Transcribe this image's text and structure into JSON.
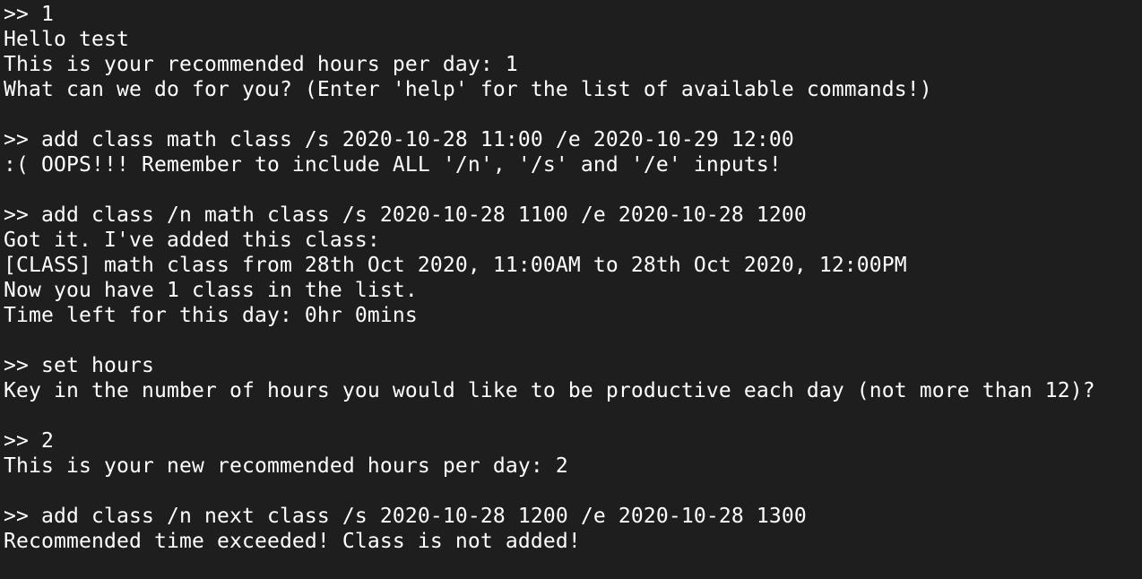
{
  "terminal": {
    "lines": [
      ">> 1",
      "Hello test",
      "This is your recommended hours per day: 1",
      "What can we do for you? (Enter 'help' for the list of available commands!)",
      "",
      ">> add class math class /s 2020-10-28 11:00 /e 2020-10-29 12:00",
      ":( OOPS!!! Remember to include ALL '/n', '/s' and '/e' inputs!",
      "",
      ">> add class /n math class /s 2020-10-28 1100 /e 2020-10-28 1200",
      "Got it. I've added this class:",
      "[CLASS] math class from 28th Oct 2020, 11:00AM to 28th Oct 2020, 12:00PM",
      "Now you have 1 class in the list.",
      "Time left for this day: 0hr 0mins",
      "",
      ">> set hours",
      "Key in the number of hours you would like to be productive each day (not more than 12)?",
      "",
      ">> 2",
      "This is your new recommended hours per day: 2",
      "",
      ">> add class /n next class /s 2020-10-28 1200 /e 2020-10-28 1300",
      "Recommended time exceeded! Class is not added!"
    ]
  }
}
